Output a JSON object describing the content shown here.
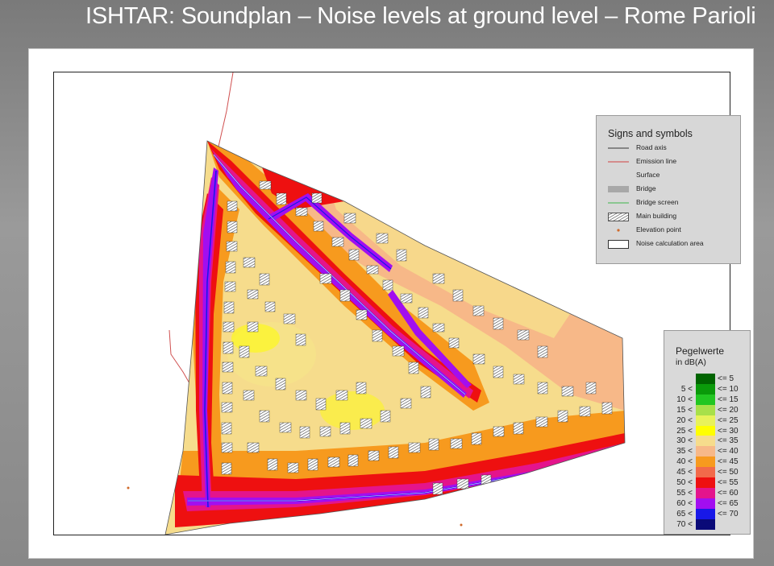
{
  "title": "ISHTAR: Soundplan – Noise levels at ground level – Rome Parioli",
  "signs": {
    "heading": "Signs and symbols",
    "items": [
      {
        "label": "Road axis",
        "symbol": "line",
        "color": "#333333"
      },
      {
        "label": "Emission line",
        "symbol": "line",
        "color": "#d04040"
      },
      {
        "label": "Surface",
        "symbol": "none",
        "color": ""
      },
      {
        "label": "Bridge",
        "symbol": "fill",
        "color": "#a8a8a8"
      },
      {
        "label": "Bridge screen",
        "symbol": "line",
        "color": "#3cb44b"
      },
      {
        "label": "Main building",
        "symbol": "hatch",
        "color": "#444444"
      },
      {
        "label": "Elevation point",
        "symbol": "point",
        "color": "#d06a2a"
      },
      {
        "label": "Noise calculation area",
        "symbol": "box",
        "color": "#333333"
      }
    ]
  },
  "legend": {
    "title": "Pegelwerte",
    "unit": "in dB(A)",
    "rows": [
      {
        "lo": "",
        "hi": "<=  5",
        "color": "#006400"
      },
      {
        "lo": "5 <",
        "hi": "<= 10",
        "color": "#0a9a0a"
      },
      {
        "lo": "10 <",
        "hi": "<= 15",
        "color": "#22c622"
      },
      {
        "lo": "15 <",
        "hi": "<= 20",
        "color": "#a8e04a"
      },
      {
        "lo": "20 <",
        "hi": "<= 25",
        "color": "#e8f25a"
      },
      {
        "lo": "25 <",
        "hi": "<= 30",
        "color": "#ffff00"
      },
      {
        "lo": "30 <",
        "hi": "<= 35",
        "color": "#f6dc8c"
      },
      {
        "lo": "35 <",
        "hi": "<= 40",
        "color": "#f7b888"
      },
      {
        "lo": "40 <",
        "hi": "<= 45",
        "color": "#f79a1e"
      },
      {
        "lo": "45 <",
        "hi": "<= 50",
        "color": "#f26a4a"
      },
      {
        "lo": "50 <",
        "hi": "<= 55",
        "color": "#ee1010"
      },
      {
        "lo": "55 <",
        "hi": "<= 60",
        "color": "#e4148c"
      },
      {
        "lo": "60 <",
        "hi": "<= 65",
        "color": "#a20ef0"
      },
      {
        "lo": "65 <",
        "hi": "<= 70",
        "color": "#1818e8"
      },
      {
        "lo": "70 <",
        "hi": "",
        "color": "#0a0a78"
      }
    ]
  }
}
